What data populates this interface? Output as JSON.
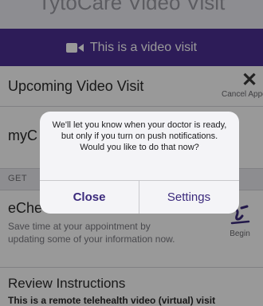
{
  "header": {
    "title": "TytoCare Video Visit"
  },
  "banner": {
    "icon": "video-camera-icon",
    "text": "This is a video visit"
  },
  "upcoming": {
    "title": "Upcoming Video Visit",
    "cancel_label": "Cancel Appointment"
  },
  "myc_row": {
    "title": "myC"
  },
  "section": {
    "label": "GET"
  },
  "echeckin": {
    "title": "eChe",
    "description": "Save time at your appointment by updating some of your information now.",
    "begin_label": "Begin"
  },
  "review": {
    "title": "Review Instructions",
    "text": "This is a remote telehealth video (virtual) visit"
  },
  "alert": {
    "message": "We'll let you know when your doctor is ready, but only if you turn on push notifications. Would you like to do that now?",
    "close_label": "Close",
    "settings_label": "Settings"
  },
  "colors": {
    "banner_bg": "#4b2f93",
    "alert_button": "#3b2a7c"
  }
}
